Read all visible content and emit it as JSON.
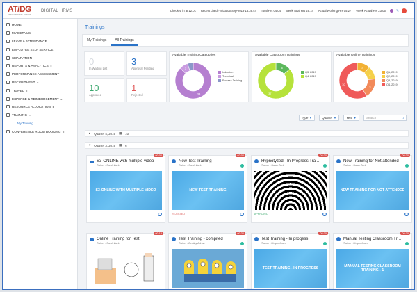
{
  "header": {
    "logo_text": "AT/DG",
    "logo_sub": "AKSHA DIGITAL GROUP",
    "app_title": "DIGITAL HRMS",
    "checked_in": "Checked in at 12:01",
    "recent_check": "Recent check-in/out 05-Sep-2019 16:39:44",
    "total_hrs": "Total Hrs 04:04",
    "week_total": "Week Total Hrs 25:14",
    "actual_working": "Actual Working Hrs 05:27",
    "week_actual": "Week Actual Hrs 23:05"
  },
  "sidebar": {
    "items": [
      {
        "label": "HOME",
        "caret": ""
      },
      {
        "label": "MY DETAILS",
        "caret": ""
      },
      {
        "label": "LEAVE & ATTENDANCE",
        "caret": ""
      },
      {
        "label": "EMPLOYEE SELF SERVICE",
        "caret": ""
      },
      {
        "label": "SEPARATION",
        "caret": ""
      },
      {
        "label": "REPORTS & ANALYTICS",
        "caret": "▸"
      },
      {
        "label": "PERFORMANCE ASSESSMENT",
        "caret": ""
      },
      {
        "label": "RECRUITMENT",
        "caret": "▸"
      },
      {
        "label": "TRAVEL",
        "caret": "▸"
      },
      {
        "label": "EXPENSE & REIMBURSEMENT",
        "caret": "▸"
      },
      {
        "label": "RESOURCE ALLOCATION",
        "caret": "▸"
      },
      {
        "label": "TRAINING",
        "caret": "▾"
      },
      {
        "label": "My Training",
        "caret": ""
      },
      {
        "label": "CONFERENCE ROOM BOOKING",
        "caret": "▸"
      }
    ]
  },
  "page": {
    "title": "Trainings",
    "tabs": [
      "My Trainings",
      "All Trainings"
    ]
  },
  "stats": [
    {
      "num": "0",
      "label": "In Waiting List",
      "color": "#d7dbe0"
    },
    {
      "num": "3",
      "label": "Approval Pending",
      "color": "#2a73c8"
    },
    {
      "num": "10",
      "label": "Approved",
      "color": "#3aa76d"
    },
    {
      "num": "1",
      "label": "Rejected",
      "color": "#e05a5a"
    }
  ],
  "charts": [
    {
      "title": "Available Training Categories",
      "legend": [
        "Induction",
        "Technical",
        "Process Training"
      ],
      "colors": [
        "#b57fd0",
        "#c99be0",
        "#8b97c9"
      ],
      "values": [
        34,
        3,
        2
      ],
      "labels": [
        "34",
        "3",
        ""
      ]
    },
    {
      "title": "Available Classroom Trainings",
      "legend": [
        "Q3, 2019",
        "Q4, 2019"
      ],
      "colors": [
        "#5cb85c",
        "#b6e23b"
      ],
      "values": [
        6,
        37
      ],
      "labels": [
        "6",
        "37"
      ]
    },
    {
      "title": "Available Online Trainings",
      "legend": [
        "Q1, 2019",
        "Q2, 2019",
        "Q3, 2019",
        "Q4, 2019"
      ],
      "colors": [
        "#f2b134",
        "#f5d04a",
        "#f28a5a",
        "#ef5a5a"
      ],
      "values": [
        2,
        2,
        3,
        10
      ],
      "labels": [
        "2",
        "2",
        "3",
        "10"
      ]
    }
  ],
  "filters": {
    "type": "Type",
    "quarter": "Quarter",
    "year": "Year",
    "search_placeholder": "Search"
  },
  "quarters": [
    {
      "label": "Quarter 4, 2019",
      "count": "10"
    },
    {
      "label": "Quarter 3, 2019",
      "count": "6"
    }
  ],
  "trainings": [
    {
      "title": "S3-ONLINE with multiple video",
      "trainer": "Trainer - Sarah Zack",
      "time": "00:00",
      "thumb": "S3-ONLINE WITH MULTIPLE VIDEO",
      "status": "",
      "icon": "video"
    },
    {
      "title": "New Test Training",
      "trainer": "Trainer - Sarah Zack",
      "time": "02:00",
      "thumb": "NEW TEST TRAINING",
      "status": "REJECTED",
      "icon": "person"
    },
    {
      "title": "Hypnotyzed - In Progress Training",
      "trainer": "Trainer - Sarah Zack",
      "time": "06:30",
      "thumb": "",
      "status": "APPROVED",
      "icon": "person"
    },
    {
      "title": "New Training for Not attended",
      "trainer": "Trainer - Sarah Zack",
      "time": "00:30",
      "thumb": "NEW TRAINING FOR NOT ATTENDED",
      "status": "",
      "icon": "person"
    },
    {
      "title": "Online Training for Test",
      "trainer": "Trainer - Sarah Zack",
      "time": "00:15",
      "thumb": "",
      "status": "",
      "icon": "video"
    },
    {
      "title": "Test Training - compited",
      "trainer": "Trainer - Destiny Adrian",
      "time": "00:30",
      "thumb": "",
      "status": "",
      "icon": "person"
    },
    {
      "title": "Test Training - In progess",
      "trainer": "Trainer - Megan Grace",
      "time": "06:30",
      "thumb": "TEST TRAINING - IN PROGRESS",
      "status": "",
      "icon": "person"
    },
    {
      "title": "Manual Testing Classroom Training - 1",
      "trainer": "Trainer - Megan Grace",
      "time": "00:30",
      "thumb": "MANUAL TESTING CLASSROOM TRAINING - 1",
      "status": "",
      "icon": "person"
    }
  ]
}
